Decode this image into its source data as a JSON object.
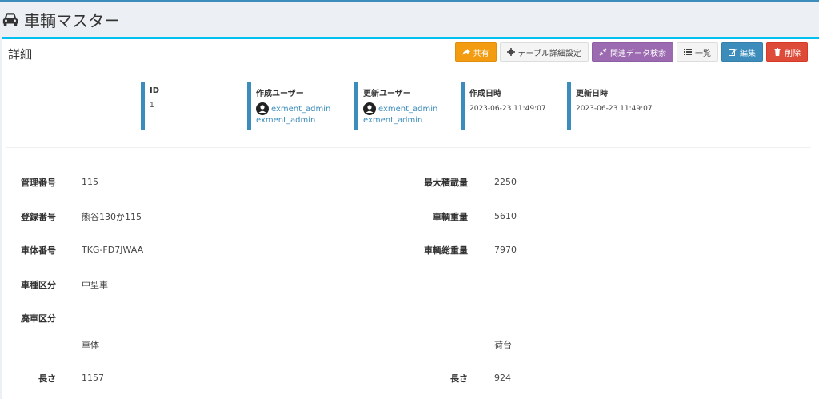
{
  "header": {
    "title": "車輌マスター"
  },
  "box": {
    "title": "詳細"
  },
  "toolbar": {
    "share": "共有",
    "table_settings": "テーブル詳細設定",
    "related_search": "関連データ検索",
    "list": "一覧",
    "edit": "編集",
    "delete": "削除"
  },
  "meta": {
    "id_label": "ID",
    "id_value": "1",
    "created_user_label": "作成ユーザー",
    "created_user_name": "exment_admin",
    "created_user_name2": "exment_admin",
    "updated_user_label": "更新ユーザー",
    "updated_user_name": "exment_admin",
    "updated_user_name2": "exment_admin",
    "created_at_label": "作成日時",
    "created_at_value": "2023-06-23 11:49:07",
    "updated_at_label": "更新日時",
    "updated_at_value": "2023-06-23 11:49:07"
  },
  "fields": {
    "kanri_label": "管理番号",
    "kanri_value": "115",
    "toroku_label": "登録番号",
    "toroku_value": "熊谷130か115",
    "shatai_label": "車体番号",
    "shatai_value": "TKG-FD7JWAA",
    "shashu_label": "車種区分",
    "shashu_value": "中型車",
    "haisha_label": "廃車区分",
    "max_load_label": "最大積載量",
    "max_load_value": "2250",
    "weight_label": "車輌重量",
    "weight_value": "5610",
    "gross_label": "車輌総重量",
    "gross_value": "7970",
    "body_section": "車体",
    "bed_section": "荷台",
    "body_length_label": "長さ",
    "body_length_value": "1157",
    "bed_length_label": "長さ",
    "bed_length_value": "924"
  }
}
